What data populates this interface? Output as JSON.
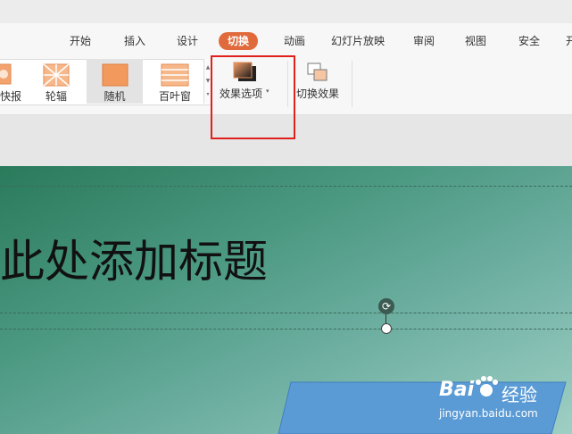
{
  "menu": {
    "tabs": [
      {
        "label": "开始"
      },
      {
        "label": "插入"
      },
      {
        "label": "设计"
      },
      {
        "label": "切换",
        "active": true
      },
      {
        "label": "动画"
      },
      {
        "label": "幻灯片放映"
      },
      {
        "label": "审阅"
      },
      {
        "label": "视图"
      },
      {
        "label": "安全"
      },
      {
        "label": "开"
      }
    ]
  },
  "ribbon": {
    "gallery_items": [
      {
        "label": "快报"
      },
      {
        "label": "轮辐"
      },
      {
        "label": "随机",
        "selected": true
      },
      {
        "label": "百叶窗"
      }
    ],
    "effect_options_label": "效果选项",
    "switch_effect_label": "切换效果"
  },
  "slide": {
    "title": "此处添加标题"
  },
  "watermark": {
    "brand_text": "Bai",
    "brand_suffix": "经验",
    "url": "jingyan.baidu.com"
  },
  "colors": {
    "accent": "#e06a3b",
    "highlight": "#e0201a",
    "shape_fill": "#5b9bd5"
  }
}
